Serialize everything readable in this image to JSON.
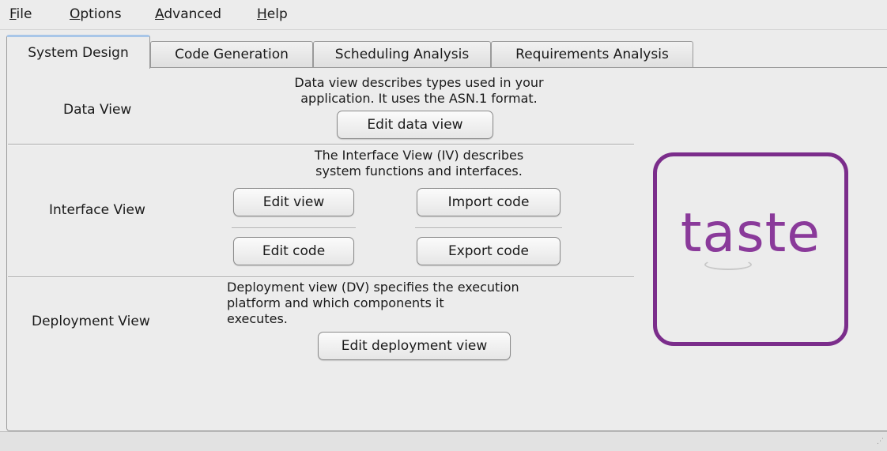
{
  "menubar": {
    "items": [
      {
        "mnemonic": "F",
        "rest": "ile"
      },
      {
        "mnemonic": "O",
        "rest": "ptions"
      },
      {
        "mnemonic": "A",
        "rest": "dvanced"
      },
      {
        "mnemonic": "H",
        "rest": "elp"
      }
    ]
  },
  "tabs": [
    {
      "label": "System Design",
      "active": true
    },
    {
      "label": "Code Generation",
      "active": false
    },
    {
      "label": "Scheduling Analysis",
      "active": false
    },
    {
      "label": "Requirements Analysis",
      "active": false
    }
  ],
  "data_view": {
    "label": "Data View",
    "description": "Data view describes types used in your\napplication. It uses the ASN.1 format.",
    "edit_button": "Edit data view"
  },
  "interface_view": {
    "label": "Interface View",
    "description": "The Interface View (IV) describes\nsystem functions and interfaces.",
    "edit_view_button": "Edit view",
    "import_code_button": "Import code",
    "edit_code_button": "Edit code",
    "export_code_button": "Export code"
  },
  "deployment_view": {
    "label": "Deployment View",
    "description": "Deployment view (DV) specifies the execution\nplatform and which components it\nexecutes.",
    "edit_button": "Edit deployment view"
  },
  "logo": {
    "text": "taste",
    "color": "#7b2d8b"
  }
}
